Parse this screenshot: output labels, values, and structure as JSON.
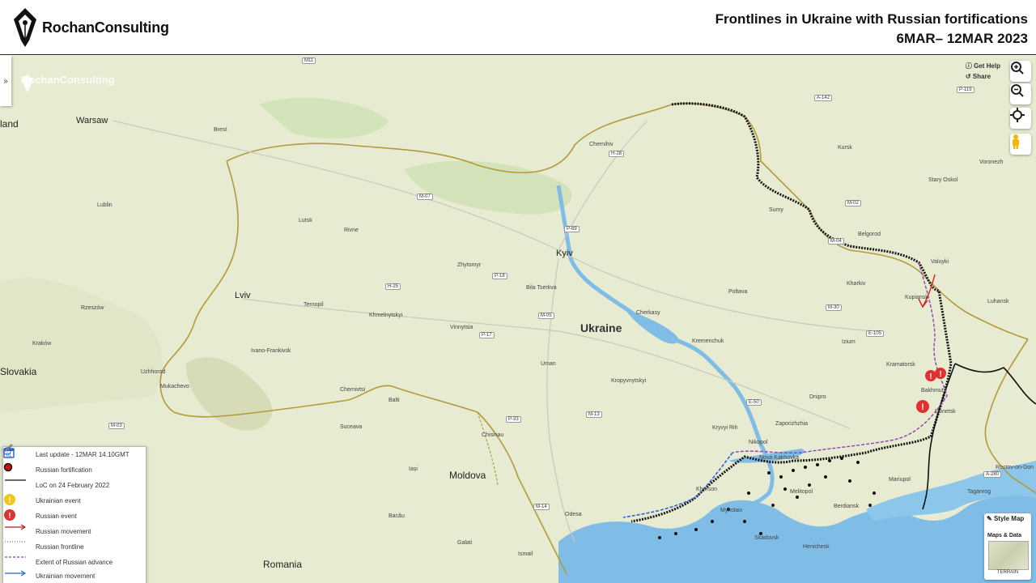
{
  "header": {
    "logo_text": "RochanConsulting",
    "title_line1": "Frontlines in Ukraine with Russian fortifications",
    "title_line2": "6MAR– 12MAR 2023"
  },
  "map": {
    "watermark": "RochanConsulting",
    "help_label": "Get Help",
    "share_label": "Share",
    "countries": {
      "ukraine": "Ukraine",
      "moldova": "Moldova",
      "romania": "Romania",
      "slovakia": "Slovakia",
      "poland": "land"
    },
    "cities": [
      "Warsaw",
      "Lviv",
      "Kyiv",
      "Kharkiv",
      "Dnipro",
      "Zaporizhzhia",
      "Odesa",
      "Chernihiv",
      "Sumy",
      "Poltava",
      "Vinnytsia",
      "Zhytomyr",
      "Rivne",
      "Lutsk",
      "Ternopil",
      "Khmelnytskyi",
      "Chernivtsi",
      "Ivano-Frankivsk",
      "Uzhhorod",
      "Mukachevo",
      "Kropyvnytskyi",
      "Mykolaiv",
      "Kherson",
      "Melitopol",
      "Mariupol",
      "Berdiansk",
      "Donetsk",
      "Luhansk",
      "Kramatorsk",
      "Bakhmut",
      "Izium",
      "Kupiansk",
      "Belgorod",
      "Kursk",
      "Voronezh",
      "Stary Oskol",
      "Valuyki",
      "Rostov-on-Don",
      "Taganrog",
      "Brest",
      "Lublin",
      "Rzeszów",
      "Kraków",
      "Bila Tserkva",
      "Uman",
      "Cherkasy",
      "Kremenchuk",
      "Nikopol",
      "Kryvyi Rih",
      "Nova Kakhovka",
      "Chisinau",
      "Balti",
      "Iași",
      "Suceava",
      "Bacău",
      "Galati",
      "Ismail",
      "Izmail",
      "Skadovsk",
      "Henichesk"
    ],
    "roads": [
      "M11",
      "M-07",
      "P-69",
      "M-02",
      "H-28",
      "P-18",
      "M-05",
      "P-17",
      "H-25",
      "M-30",
      "M-13",
      "P-33",
      "M-14",
      "E-50",
      "M-03",
      "M-04",
      "A-142",
      "P-119",
      "E-105",
      "A-280"
    ]
  },
  "controls": {
    "zoom_in": "zoom-in-icon",
    "zoom_out": "zoom-out-icon",
    "locate": "crosshair-icon",
    "street_view": "pegman-icon",
    "side_toggle": "»"
  },
  "legend": {
    "items": [
      {
        "label": "Last update - 12MAR 14.10GMT"
      },
      {
        "label": "Russian fortification"
      },
      {
        "label": "LoC on 24 February 2022"
      },
      {
        "label": "Ukrainian event"
      },
      {
        "label": "Russian event"
      },
      {
        "label": "Russian movement"
      },
      {
        "label": "Russian frontline"
      },
      {
        "label": "Extent of Russian advance"
      },
      {
        "label": "Ukrainian movement"
      }
    ]
  },
  "style_panel": {
    "style_map": "Style Map",
    "maps_data": "Maps & Data",
    "terrain": "TERRAIN"
  },
  "colors": {
    "map_land": "#e7ecd2",
    "water": "#7fbde6",
    "border": "#b59a3a",
    "front_black": "#111111",
    "russian_event": "#e03030",
    "ukrainian_event": "#f5c518",
    "russian_movement": "#b02020",
    "ukrainian_movement": "#3060d0",
    "extent_advance": "#9040b0"
  }
}
